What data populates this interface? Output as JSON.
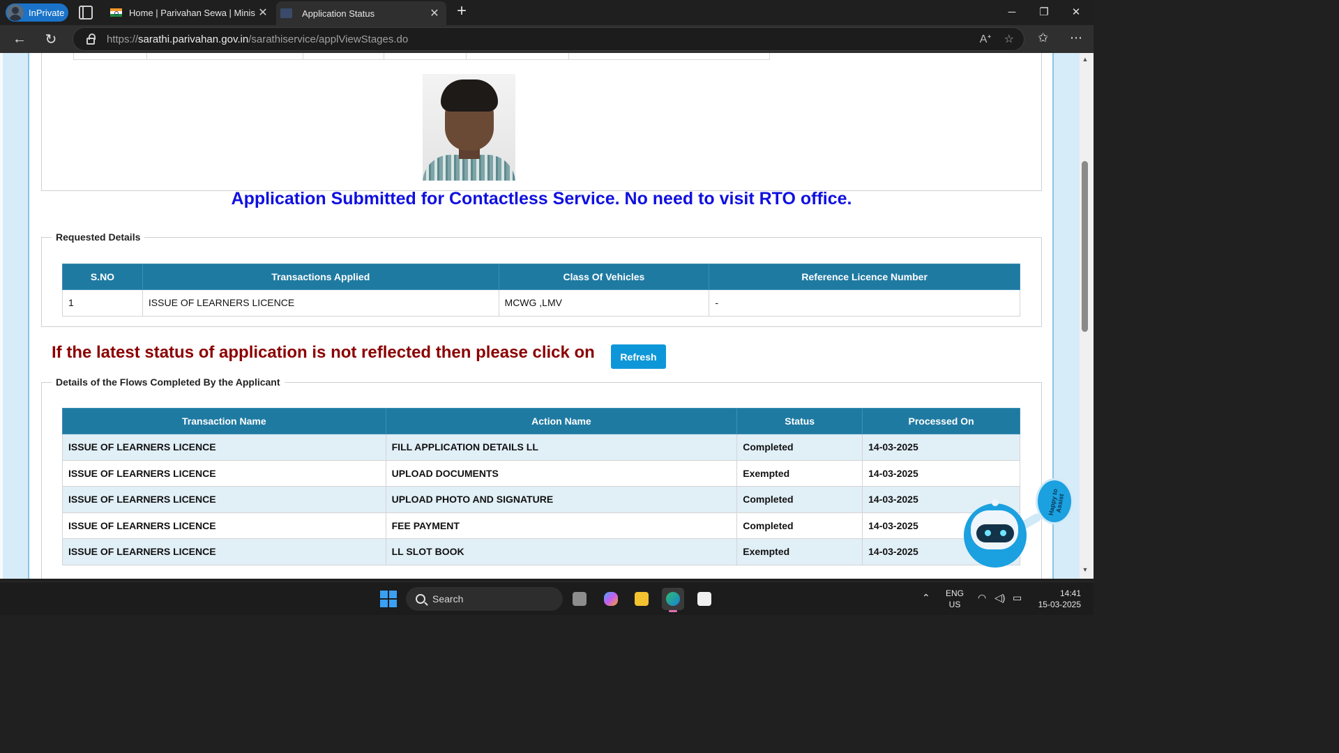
{
  "browser": {
    "inprivate_label": "InPrivate",
    "tabs": [
      {
        "title": "Home | Parivahan Sewa | Ministry",
        "close": "✕"
      },
      {
        "title": "Application Status",
        "close": "✕"
      }
    ],
    "new_tab": "+",
    "url_prefix": "https://",
    "url_host": "sarathi.parivahan.gov.in",
    "url_path": "/sarathiservice/applViewStages.do"
  },
  "page": {
    "contactless_message": "Application Submitted for Contactless Service. No need to visit RTO office.",
    "requested_details": {
      "legend": "Requested Details",
      "headers": [
        "S.NO",
        "Transactions Applied",
        "Class Of Vehicles",
        "Reference Licence Number"
      ],
      "rows": [
        [
          "1",
          "ISSUE OF LEARNERS LICENCE",
          "MCWG ,LMV",
          "-"
        ]
      ]
    },
    "refresh_prompt": "If the latest status of application is not reflected then please click on",
    "refresh_button": "Refresh",
    "flows": {
      "legend": "Details of the Flows Completed By the Applicant",
      "headers": [
        "Transaction Name",
        "Action Name",
        "Status",
        "Processed On"
      ],
      "rows": [
        [
          "ISSUE OF LEARNERS LICENCE",
          "FILL APPLICATION DETAILS LL",
          "Completed",
          "14-03-2025"
        ],
        [
          "ISSUE OF LEARNERS LICENCE",
          "UPLOAD DOCUMENTS",
          "Exempted",
          "14-03-2025"
        ],
        [
          "ISSUE OF LEARNERS LICENCE",
          "UPLOAD PHOTO AND SIGNATURE",
          "Completed",
          "14-03-2025"
        ],
        [
          "ISSUE OF LEARNERS LICENCE",
          "FEE PAYMENT",
          "Completed",
          "14-03-2025"
        ],
        [
          "ISSUE OF LEARNERS LICENCE",
          "LL SLOT BOOK",
          "Exempted",
          "14-03-2025"
        ]
      ]
    },
    "chatbot_badge": "Happy to Assist"
  },
  "taskbar": {
    "search_label": "Search",
    "lang_top": "ENG",
    "lang_bottom": "US",
    "time": "14:41",
    "date": "15-03-2025"
  },
  "colors": {
    "table_header": "#1f7aa2",
    "contactless_text": "#1010e0",
    "refresh_prompt_text": "#8b0000",
    "refresh_button": "#0e97d8",
    "alt_row": "#e1eff7"
  }
}
